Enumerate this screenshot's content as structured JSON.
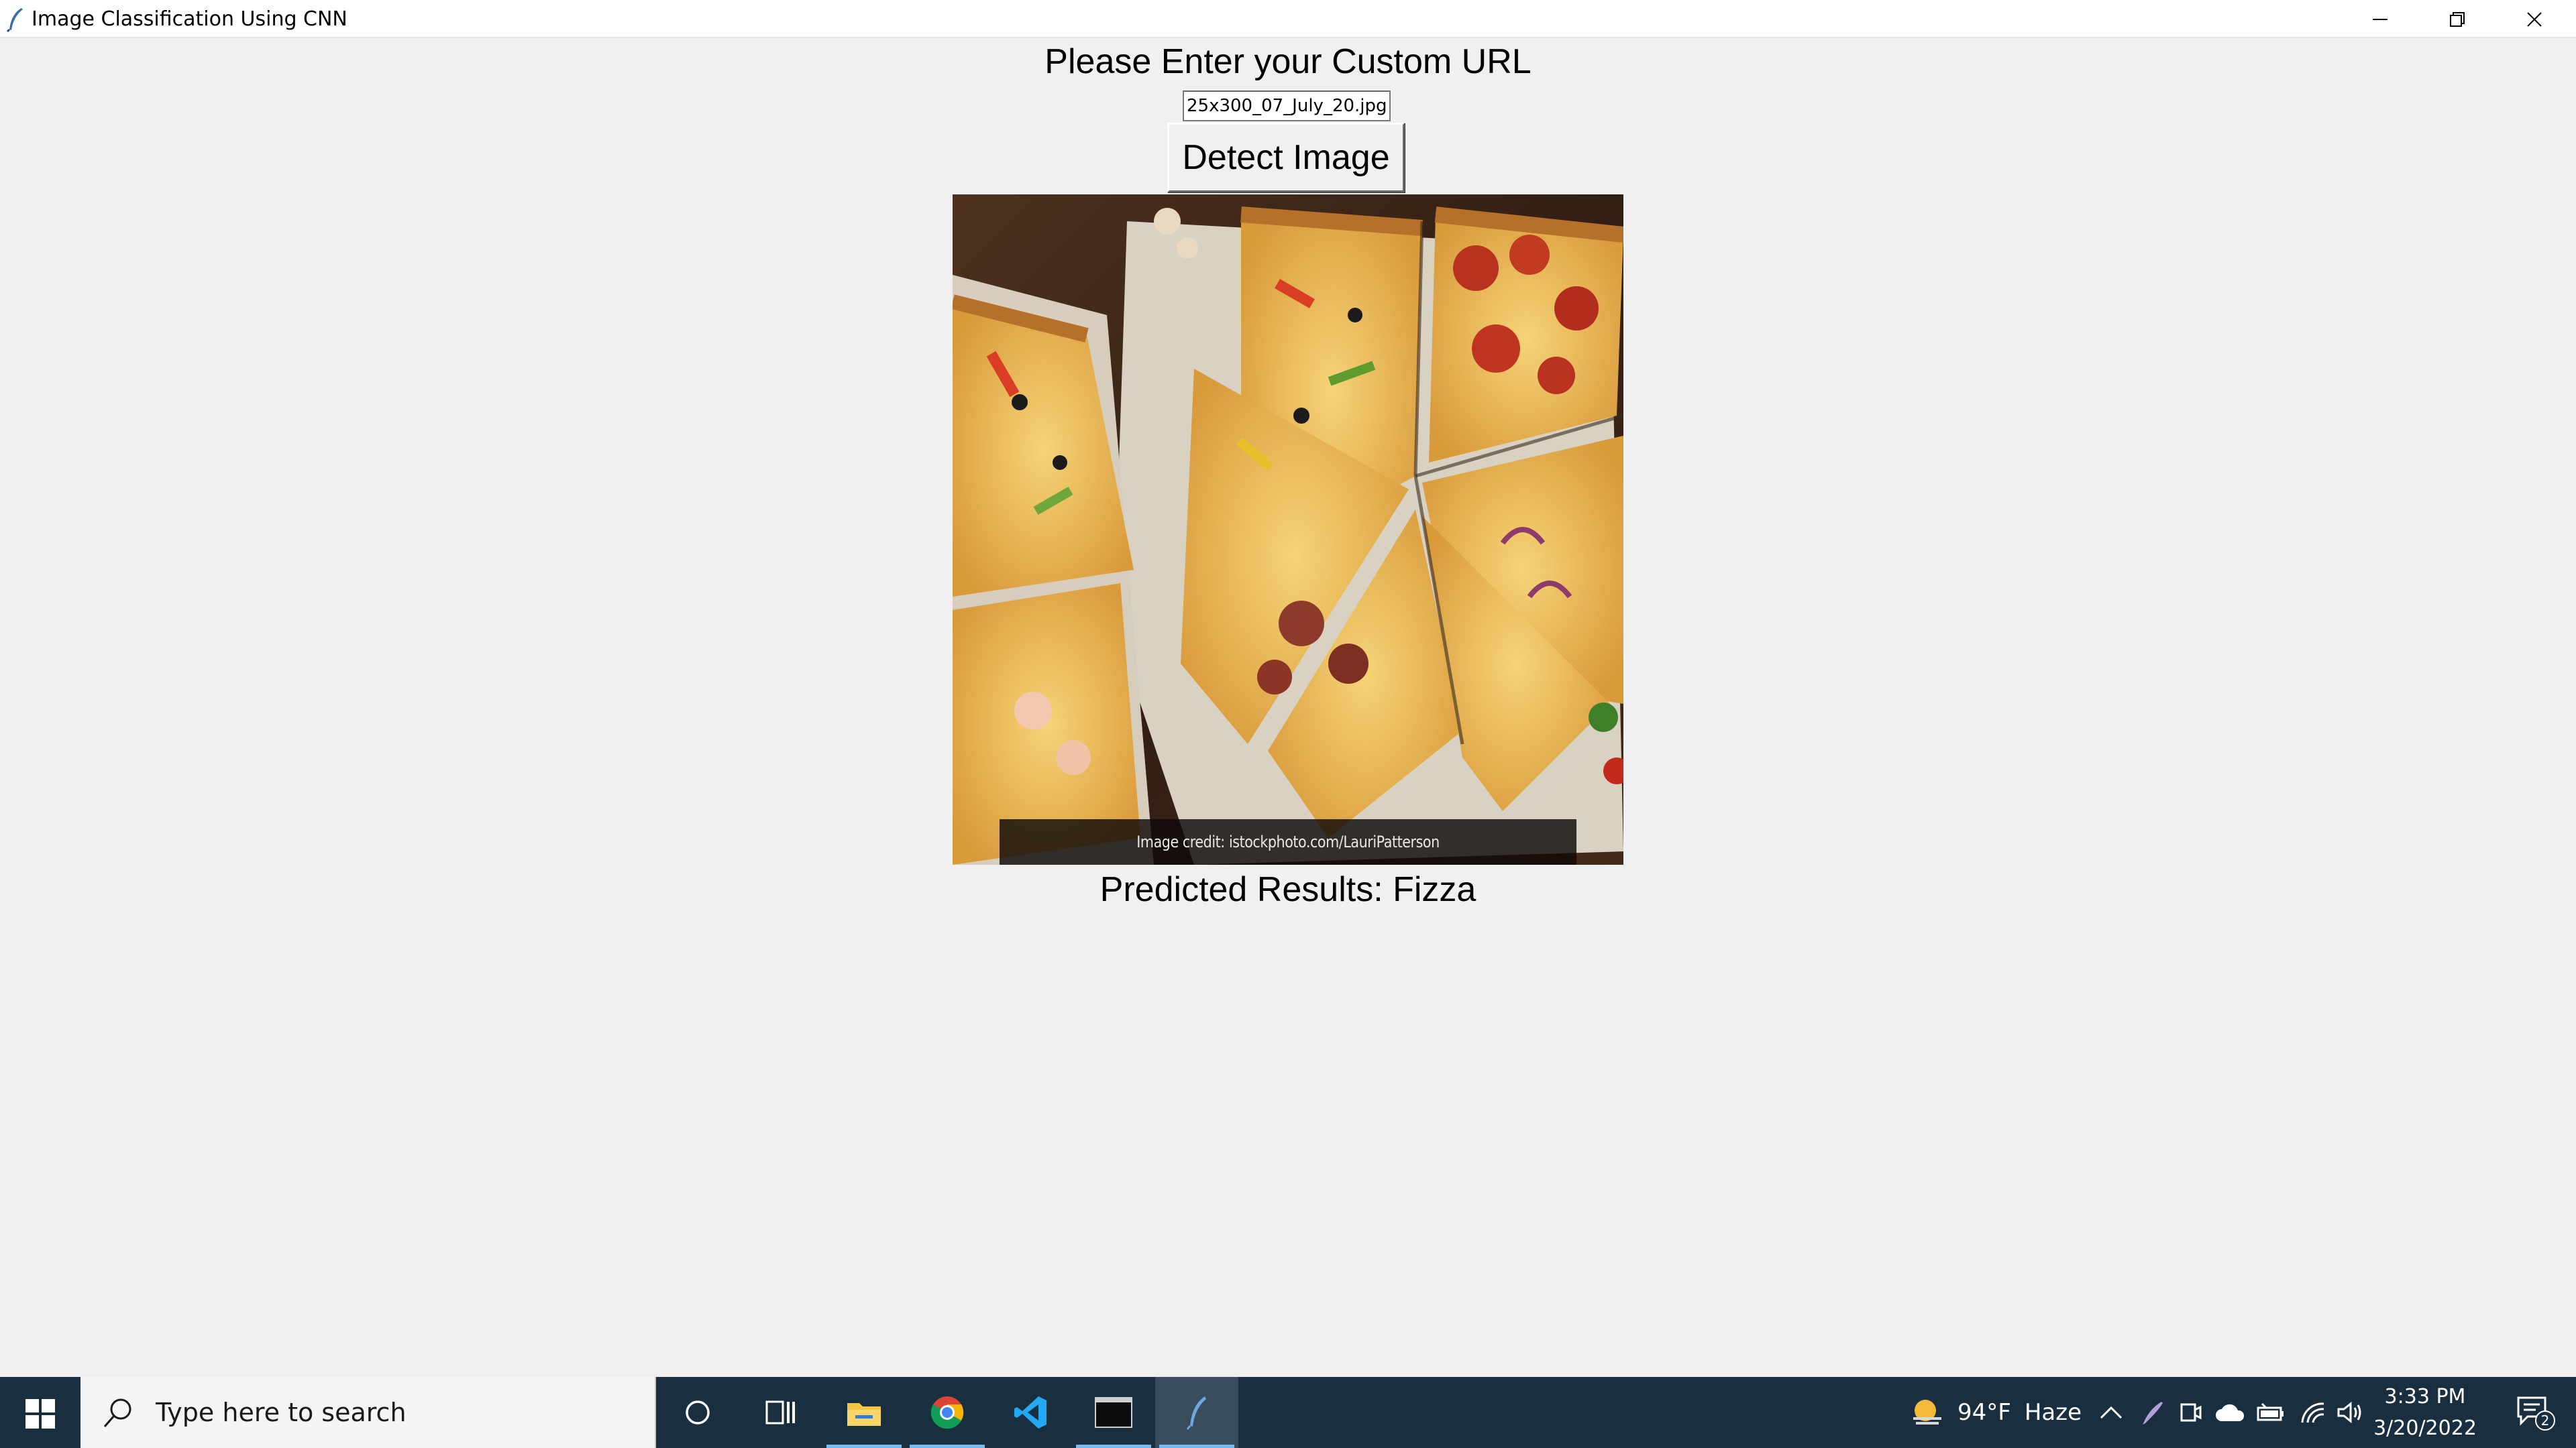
{
  "window": {
    "title": "Image Classification Using CNN",
    "controls": [
      "minimize-icon",
      "restore-icon",
      "close-icon"
    ]
  },
  "app": {
    "heading": "Please Enter your Custom URL",
    "url_input": {
      "value": "25x300_07_July_20.jpg",
      "placeholder": ""
    },
    "detect_button": "Detect Image",
    "image": {
      "subject": "pizza slices on parchment paper",
      "credit": "Image credit: istockphoto.com/LauriPatterson"
    },
    "result": "Predicted Results: Fizza"
  },
  "taskbar": {
    "start_icon": "windows-logo-icon",
    "search_placeholder": "Type here to search",
    "apps": [
      {
        "name": "cortana-icon",
        "active": false
      },
      {
        "name": "task-view-icon",
        "active": false
      },
      {
        "name": "file-explorer-icon",
        "active": false
      },
      {
        "name": "chrome-icon",
        "active": false
      },
      {
        "name": "vscode-icon",
        "active": false
      },
      {
        "name": "terminal-icon",
        "active": false
      },
      {
        "name": "python-feather-icon",
        "active": true
      }
    ],
    "weather": {
      "temp": "94°F",
      "condition": "Haze"
    },
    "tray_icons": [
      "chevron-up-icon",
      "pen-icon",
      "meet-now-icon",
      "onedrive-cloud-icon",
      "battery-icon",
      "wifi-icon",
      "speaker-icon"
    ],
    "time": "3:33 PM",
    "date": "3/20/2022",
    "notifications": "2"
  },
  "colors": {
    "app_background": "#f0f0f0",
    "taskbar": "#192e3f",
    "active_underline": "#76b9ed"
  }
}
